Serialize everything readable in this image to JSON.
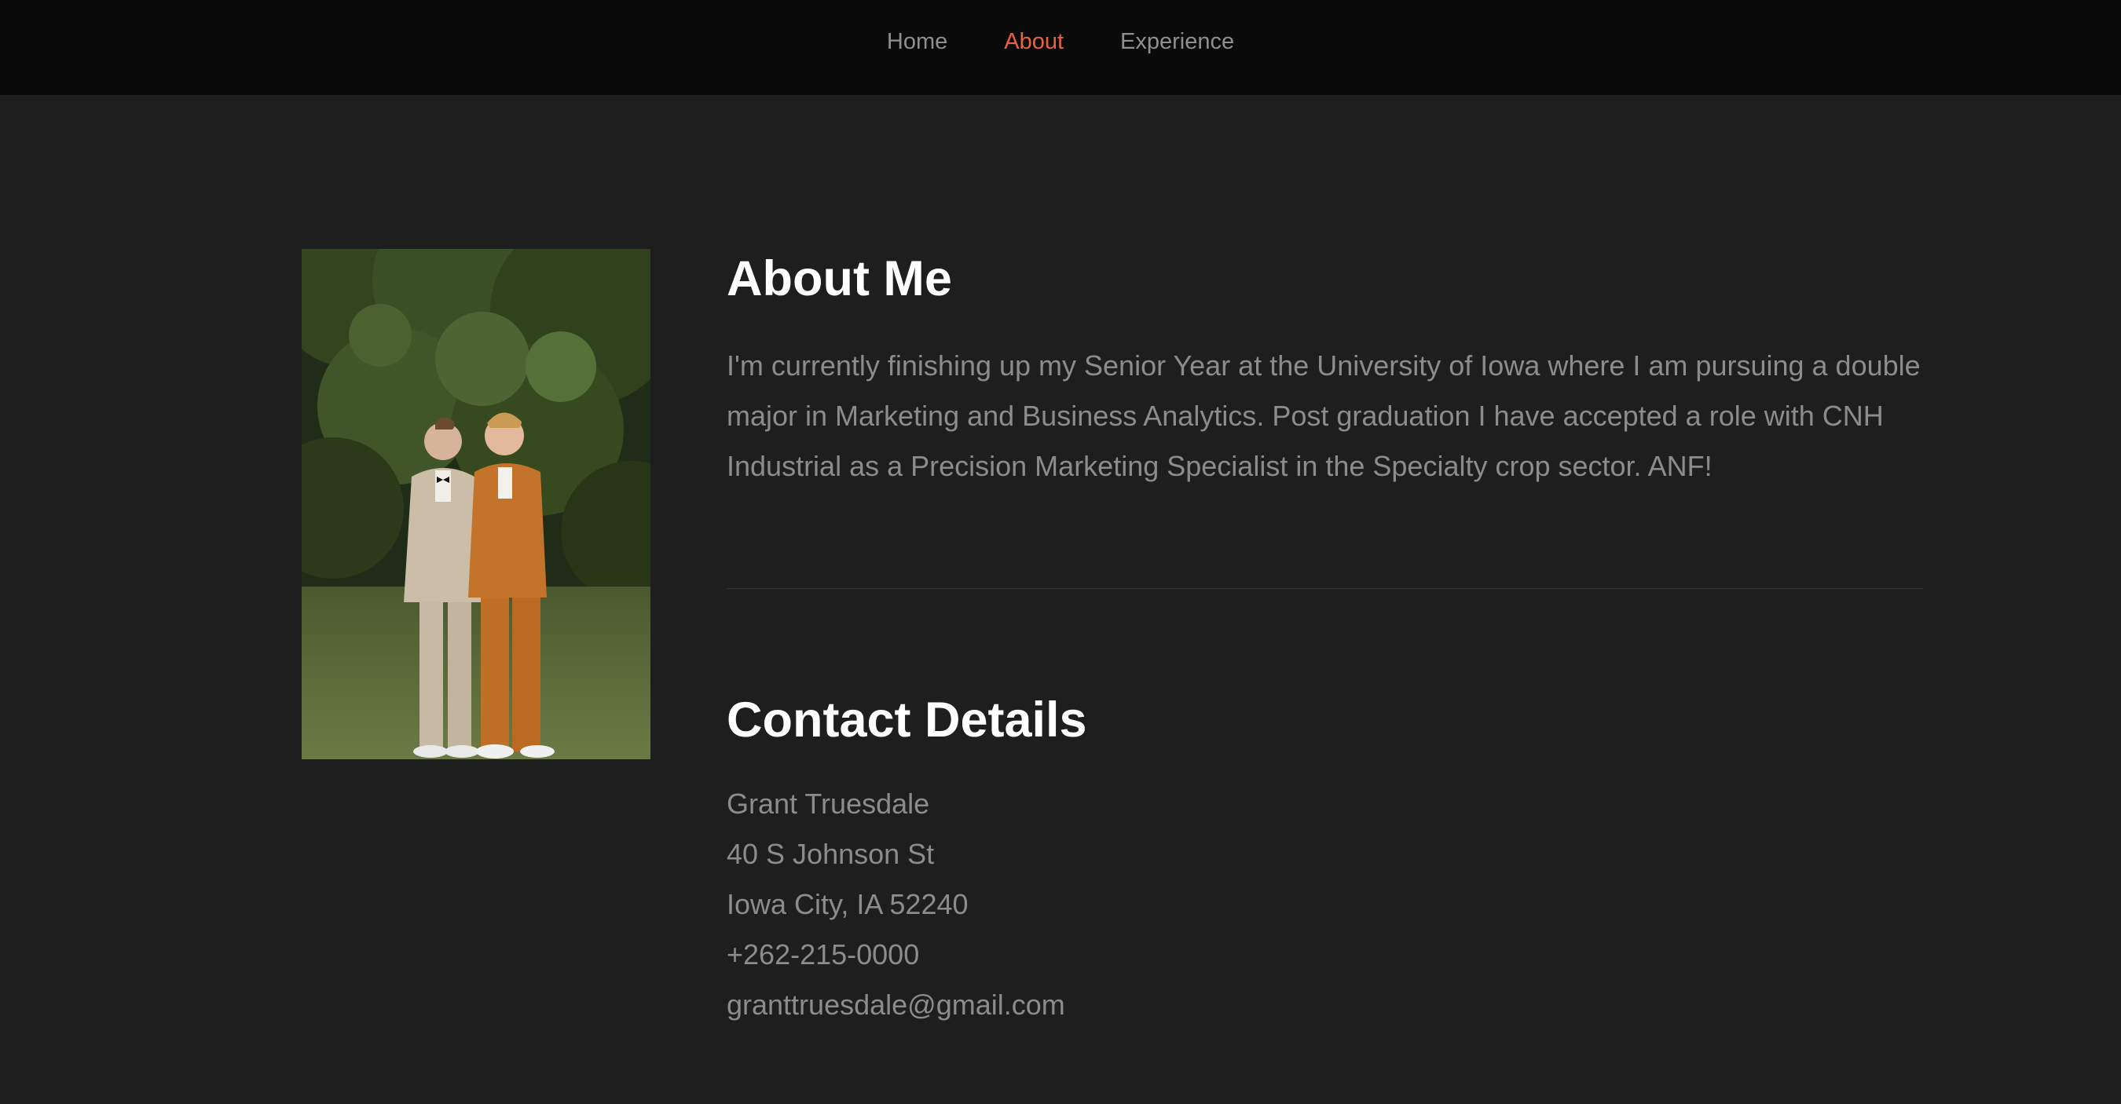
{
  "nav": {
    "items": [
      {
        "label": "Home"
      },
      {
        "label": "About"
      },
      {
        "label": "Experience"
      }
    ],
    "active_color": "#e8623f"
  },
  "about": {
    "title": "About Me",
    "body": "I'm currently finishing up my Senior Year at the University of Iowa where I am pursuing a double major in Marketing and Business Analytics. Post graduation I have accepted a role with CNH Industrial as a Precision Marketing Specialist in the Specialty crop sector. ANF!"
  },
  "contact": {
    "title": "Contact Details",
    "name": "Grant Truesdale",
    "street": "40 S Johnson St",
    "city": "Iowa City, IA 52240",
    "phone": "+262-215-0000",
    "email": "granttruesdale@gmail.com"
  },
  "colors": {
    "background": "#1e1e1e",
    "nav_background": "#0a0a0a",
    "heading": "#ffffff",
    "body_text": "#8c8c8c"
  }
}
